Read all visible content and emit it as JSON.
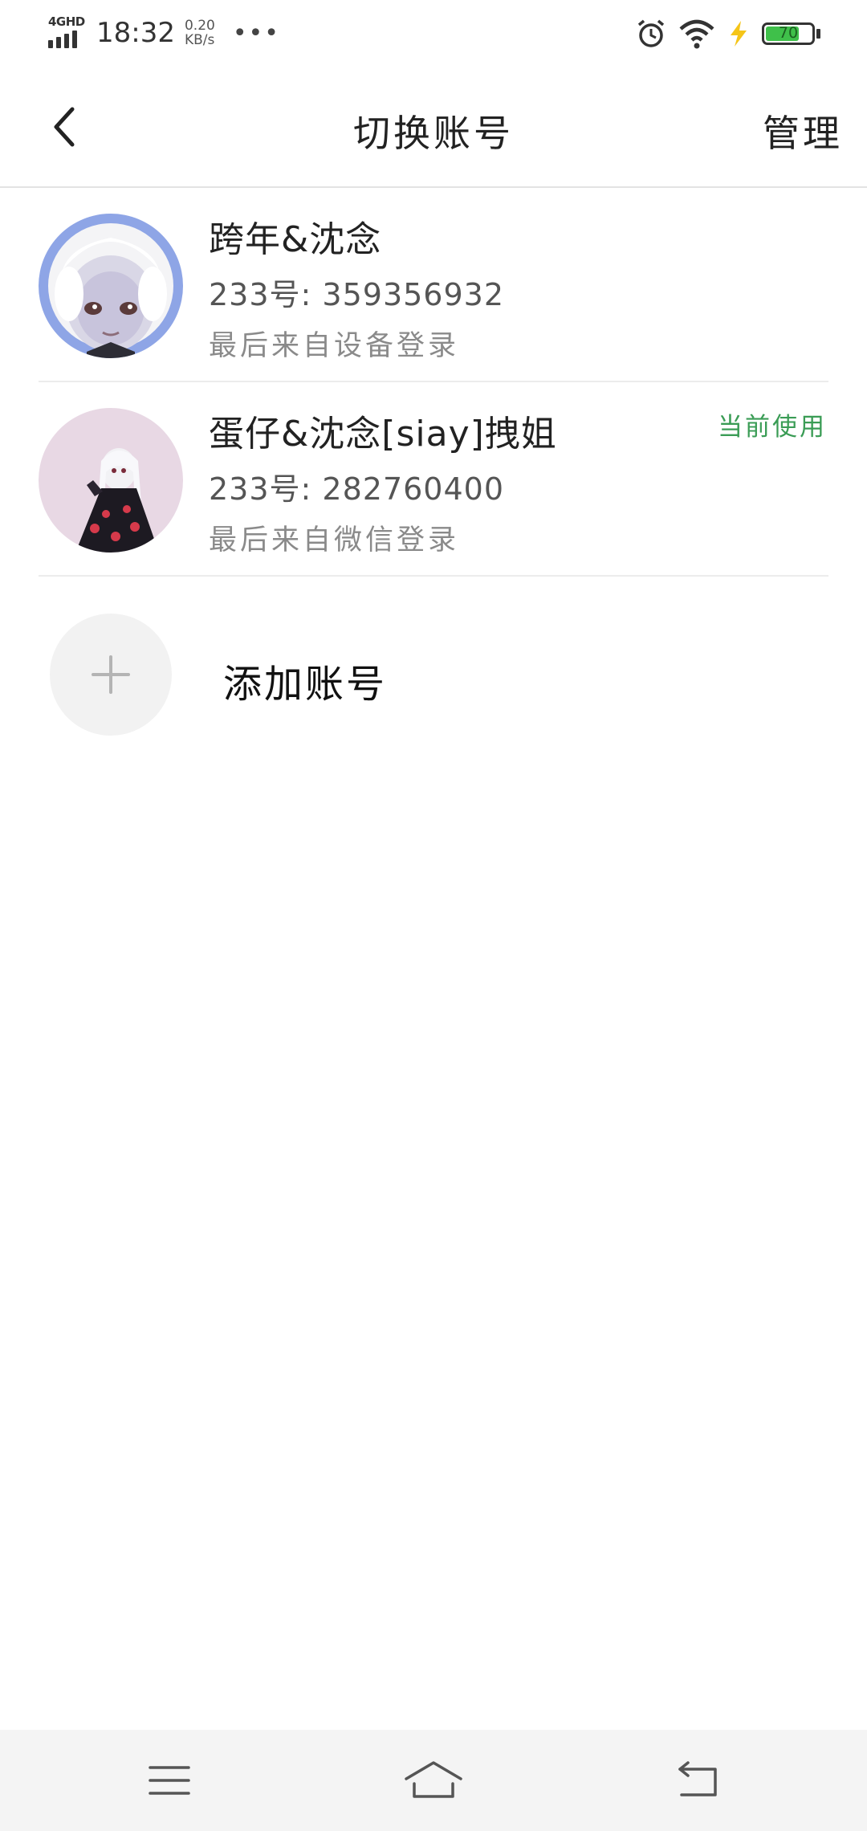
{
  "status_bar": {
    "network": "4GHD",
    "time": "18:32",
    "speed_value": "0.20",
    "speed_unit": "KB/s",
    "more": "•••",
    "battery_level": "70",
    "battery_color": "#3fc04a",
    "charging_color": "#f5c518"
  },
  "nav": {
    "title": "切换账号",
    "manage_label": "管理"
  },
  "accounts": [
    {
      "name": "跨年&沈念",
      "id_line": "233号: 359356932",
      "login_info": "最后来自设备登录",
      "current_label": ""
    },
    {
      "name": "蛋仔&沈念[siay]拽姐",
      "id_line": "233号: 282760400",
      "login_info": "最后来自微信登录",
      "current_label": "当前使用"
    }
  ],
  "add_account": {
    "label": "添加账号"
  },
  "colors": {
    "accent_green": "#3a9c55",
    "divider": "#ececec"
  },
  "system_nav": [
    "menu-icon",
    "home-icon",
    "back-icon"
  ]
}
